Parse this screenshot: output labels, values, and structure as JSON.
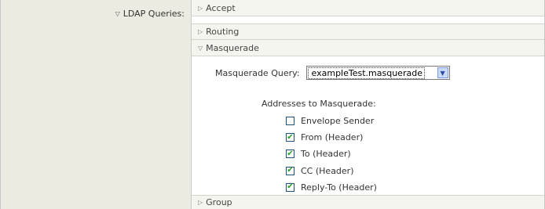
{
  "label": {
    "text": "LDAP Queries:"
  },
  "sections": {
    "accept": "Accept",
    "routing": "Routing",
    "masquerade": "Masquerade",
    "group": "Group"
  },
  "masquerade": {
    "query_label": "Masquerade Query:",
    "query_value": "exampleTest.masquerade",
    "addresses_title": "Addresses to Masquerade:",
    "options": [
      {
        "label": "Envelope Sender",
        "checked": false
      },
      {
        "label": "From (Header)",
        "checked": true
      },
      {
        "label": "To (Header)",
        "checked": true
      },
      {
        "label": "CC (Header)",
        "checked": true
      },
      {
        "label": "Reply-To (Header)",
        "checked": true
      }
    ]
  }
}
